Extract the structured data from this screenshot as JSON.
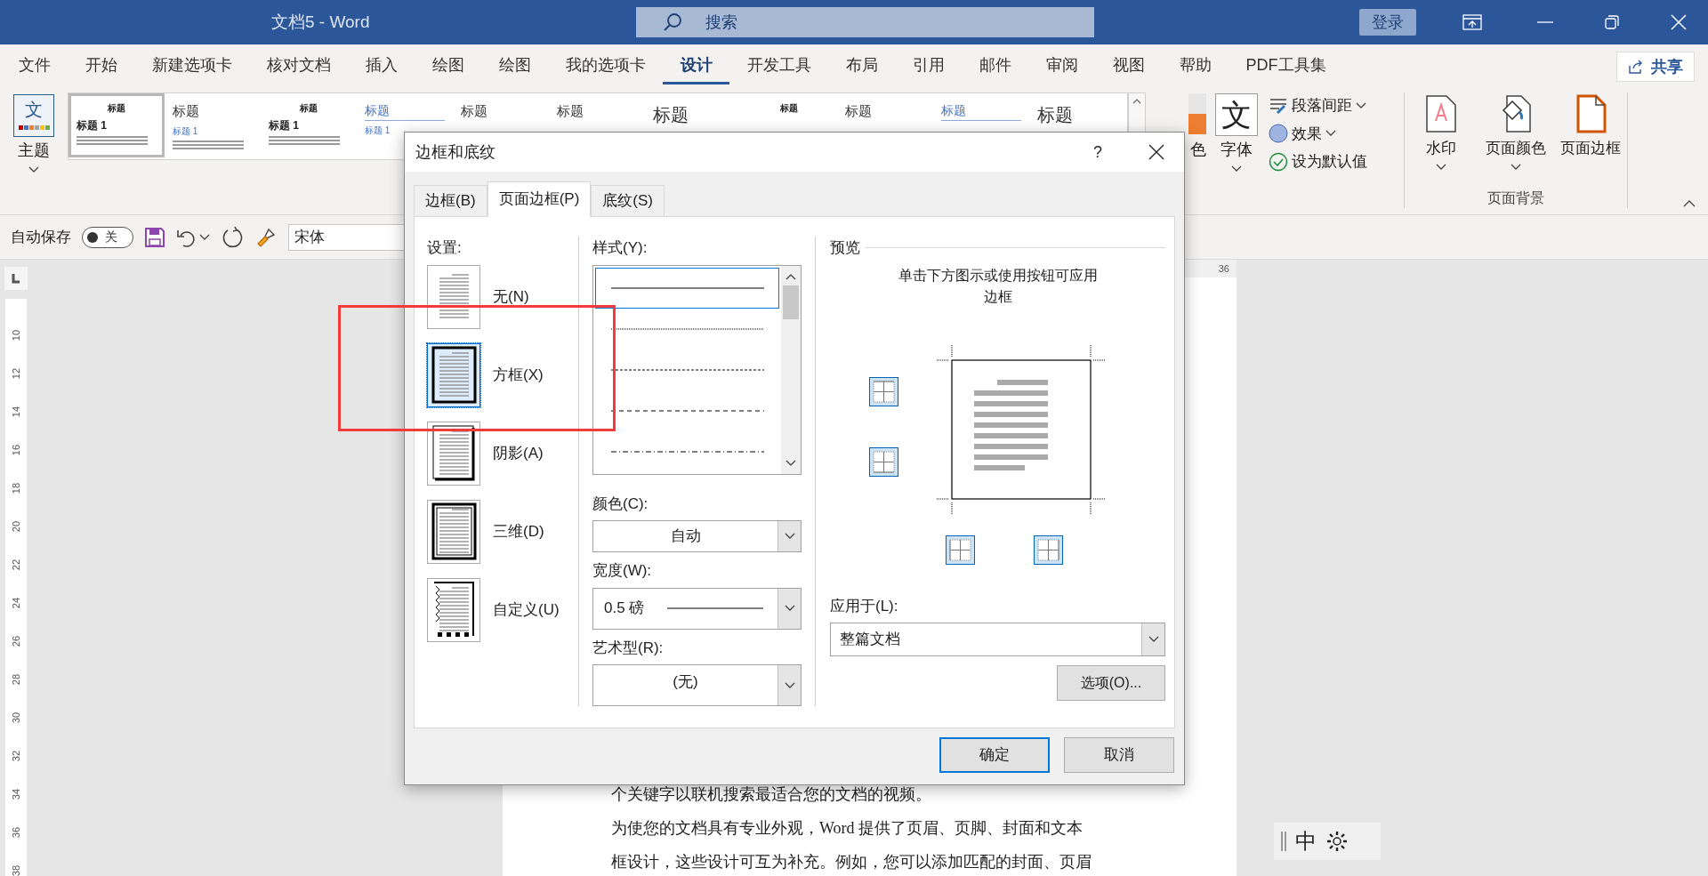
{
  "window": {
    "title": "文档5 - Word",
    "search_placeholder": "搜索",
    "sign_in": "登录"
  },
  "menu_tabs": [
    {
      "label": "文件",
      "selected": false
    },
    {
      "label": "开始",
      "selected": false
    },
    {
      "label": "新建选项卡",
      "selected": false
    },
    {
      "label": "核对文档",
      "selected": false
    },
    {
      "label": "插入",
      "selected": false
    },
    {
      "label": "绘图",
      "selected": false
    },
    {
      "label": "绘图",
      "selected": false
    },
    {
      "label": "我的选项卡",
      "selected": false
    },
    {
      "label": "设计",
      "selected": true
    },
    {
      "label": "开发工具",
      "selected": false
    },
    {
      "label": "布局",
      "selected": false
    },
    {
      "label": "引用",
      "selected": false
    },
    {
      "label": "邮件",
      "selected": false
    },
    {
      "label": "审阅",
      "selected": false
    },
    {
      "label": "视图",
      "selected": false
    },
    {
      "label": "帮助",
      "selected": false
    },
    {
      "label": "PDF工具集",
      "selected": false
    }
  ],
  "share": "共享",
  "ribbon": {
    "theme_glyph": "文",
    "theme_label": "主题",
    "fonts_glyph": "文",
    "gallery": [
      {
        "kind": "thumbnail",
        "title": "标题",
        "subtitle": "标题 1",
        "text_lines": true,
        "selected": true
      },
      {
        "kind": "plain",
        "title": "标题",
        "subtitle": "标题 1",
        "text_lines": true,
        "selected": false
      },
      {
        "kind": "small-bold",
        "title": "标题",
        "subtitle": "标题 1",
        "text_lines": true,
        "selected": false
      },
      {
        "kind": "blue",
        "title": "标题",
        "subtitle": "标题 1",
        "text_lines": false,
        "selected": false
      },
      {
        "kind": "plain",
        "title": "标题",
        "selected": false
      },
      {
        "kind": "plain",
        "title": "标题",
        "selected": false
      },
      {
        "kind": "large",
        "title": "标题",
        "selected": false
      },
      {
        "kind": "small-bold",
        "title": "标题",
        "selected": false
      },
      {
        "kind": "plain",
        "title": "标题",
        "selected": false
      },
      {
        "kind": "blue",
        "title": "标题",
        "selected": false
      },
      {
        "kind": "large",
        "title": "标题",
        "selected": false
      }
    ],
    "colors_label": "色",
    "fonts_label": "字体",
    "paragraph_spacing": "段落间距",
    "effects": "效果",
    "set_default": "设为默认值",
    "page_background": {
      "items": [
        {
          "kind": "watermark",
          "label": "水印"
        },
        {
          "kind": "page-color",
          "label": "页面颜色"
        },
        {
          "kind": "page-border",
          "label": "页面边框"
        }
      ],
      "group_label": "页面背景"
    }
  },
  "quick_access": {
    "autosave_label": "自动保存",
    "autosave": {
      "on": false,
      "label": "关"
    },
    "font": "宋体"
  },
  "ruler": {
    "top_mark": "36",
    "numbers": [
      "10",
      "12",
      "14",
      "16",
      "18",
      "20",
      "22",
      "24",
      "26",
      "28",
      "30",
      "32",
      "34",
      "36",
      "38"
    ]
  },
  "document": {
    "lines": [
      "个关键字以联机搜索最适合您的文档的视频。",
      "为使您的文档具有专业外观，Word 提供了页眉、页脚、封面和文本",
      "框设计，这些设计可互为补充。例如，您可以添加匹配的封面、页眉"
    ]
  },
  "dialog": {
    "title": "边框和底纹",
    "help": "?",
    "tabs": [
      {
        "label": "边框(B)",
        "selected": false
      },
      {
        "label": "页面边框(P)",
        "selected": true
      },
      {
        "label": "底纹(S)",
        "selected": false
      }
    ],
    "settings": {
      "label": "设置:",
      "items": [
        {
          "kind": "none",
          "label": "无(N)",
          "selected": false
        },
        {
          "kind": "box",
          "label": "方框(X)",
          "selected": true
        },
        {
          "kind": "shadow",
          "label": "阴影(A)",
          "selected": false
        },
        {
          "kind": "three-d",
          "label": "三维(D)",
          "selected": false
        },
        {
          "kind": "custom",
          "label": "自定义(U)",
          "selected": false
        }
      ]
    },
    "style": {
      "label": "样式(Y):",
      "items": [
        {
          "kind": "solid",
          "selected": true
        },
        {
          "kind": "dotted",
          "selected": false
        },
        {
          "kind": "dashed",
          "selected": false
        },
        {
          "kind": "long-dashed",
          "selected": false
        },
        {
          "kind": "dash-dot",
          "selected": false
        }
      ]
    },
    "color": {
      "label": "颜色(C):",
      "value": "自动"
    },
    "width": {
      "label": "宽度(W):",
      "value": "0.5 磅"
    },
    "art": {
      "label": "艺术型(R):",
      "value": "(无)"
    },
    "preview": {
      "label": "预览",
      "instruction": "单击下方图示或使用按钮可应用边框"
    },
    "apply": {
      "label": "应用于(L):",
      "value": "整篇文档"
    },
    "options_button": "选项(O)...",
    "ok": "确定",
    "cancel": "取消"
  },
  "ime": {
    "mode": "中"
  }
}
